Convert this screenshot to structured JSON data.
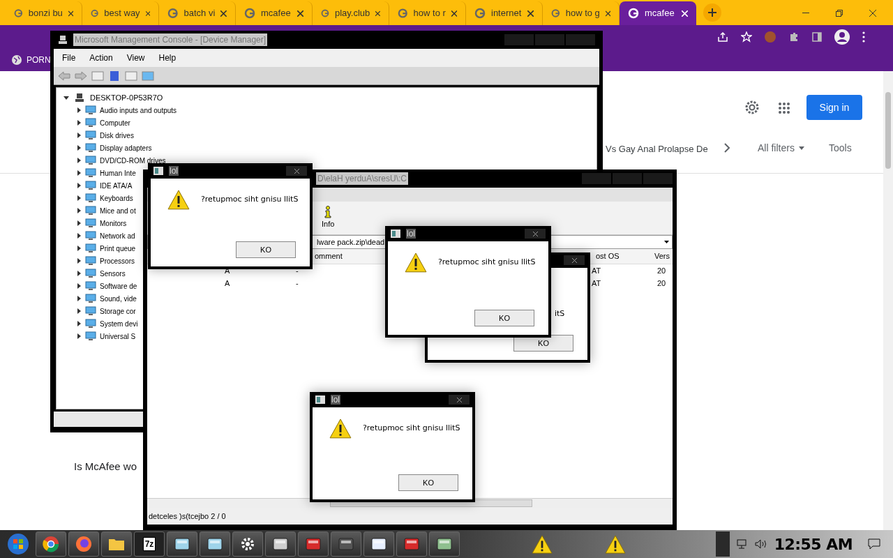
{
  "browser": {
    "tabs": [
      {
        "label": "bonzi bu",
        "selected": false
      },
      {
        "label": "best way",
        "selected": false
      },
      {
        "label": "batch vi",
        "selected": false
      },
      {
        "label": "mcafee",
        "selected": false
      },
      {
        "label": "play.club",
        "selected": false
      },
      {
        "label": "how to r",
        "selected": false
      },
      {
        "label": "internet",
        "selected": false
      },
      {
        "label": "how to g",
        "selected": false
      },
      {
        "label": "mcafee",
        "selected": true
      }
    ],
    "bookmark": "PORN",
    "page": {
      "sign_in": "Sign in",
      "chip": "Vs Gay Anal Prolapse De",
      "all_filters": "All filters",
      "tools": "Tools",
      "result": "Is McAfee wo"
    }
  },
  "device_manager": {
    "title": "Microsoft Management Console - [Device Manager]",
    "menu": [
      "File",
      "Action",
      "View",
      "Help"
    ],
    "root": {
      "label": "DESKTOP-0P53R7O",
      "expanded": true
    },
    "items": [
      {
        "label": "Audio inputs and outputs",
        "expanded": false
      },
      {
        "label": "Computer",
        "expanded": false
      },
      {
        "label": "Disk drives",
        "expanded": false
      },
      {
        "label": "Display adapters",
        "expanded": false
      },
      {
        "label": "DVD/CD-ROM drives",
        "expanded": false
      },
      {
        "label": "Human Inte",
        "expanded": false
      },
      {
        "label": "IDE ATA/A",
        "expanded": false
      },
      {
        "label": "Keyboards",
        "expanded": false
      },
      {
        "label": "Mice and ot",
        "expanded": false
      },
      {
        "label": "Monitors",
        "expanded": false
      },
      {
        "label": "Network ad",
        "expanded": false
      },
      {
        "label": "Print queue",
        "expanded": false
      },
      {
        "label": "Processors",
        "expanded": false
      },
      {
        "label": "Sensors",
        "expanded": false
      },
      {
        "label": "Software de",
        "expanded": false
      },
      {
        "label": "Sound, vide",
        "expanded": false
      },
      {
        "label": "Storage cor",
        "expanded": false
      },
      {
        "label": "System devi",
        "expanded": false
      },
      {
        "label": "Universal S",
        "expanded": false
      }
    ]
  },
  "archive_window": {
    "title": "D\\elaH yerduA\\sresU\\:C",
    "toolbar": [
      "Info"
    ],
    "path": "lware pack.zip\\dead",
    "columns": [
      "",
      "omment",
      "ost OS",
      "Vers"
    ],
    "rows": [
      [
        "A",
        "-",
        "AT",
        "20"
      ],
      [
        "A",
        "-",
        "AT",
        "20"
      ]
    ],
    "status": "detceles )s(tcejbo 2 / 0"
  },
  "dialogs": [
    {
      "title": "lol",
      "message": "?retupmoc siht gnisu llitS",
      "button": "KO"
    },
    {
      "message": "itS",
      "button": "KO"
    },
    {
      "title": "lol",
      "message": "?retupmoc siht gnisu llitS",
      "button": "KO"
    },
    {
      "title": "lol",
      "message": "?retupmoc siht gnisu llitS",
      "button": "KO"
    }
  ],
  "taskbar": {
    "archiver_label": "7z",
    "clock": "12:55 AM"
  }
}
